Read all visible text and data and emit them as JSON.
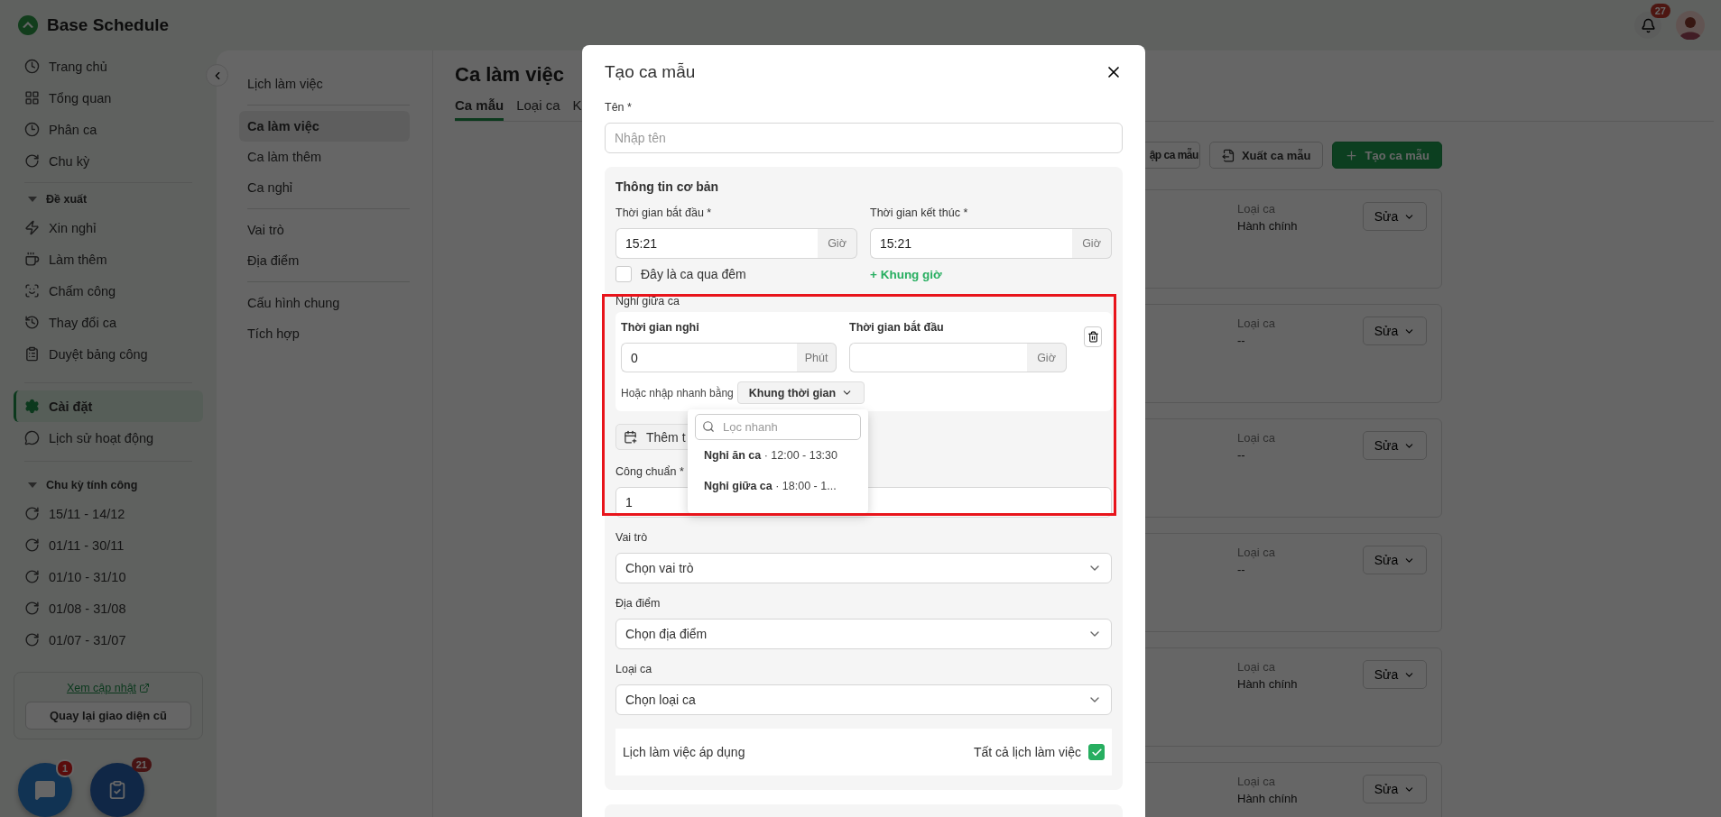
{
  "app": {
    "name": "Base Schedule",
    "notifications": "27"
  },
  "sidebar": {
    "main": [
      {
        "label": "Trang chủ",
        "selected": false
      },
      {
        "label": "Tổng quan",
        "selected": false
      },
      {
        "label": "Phân ca",
        "selected": false
      },
      {
        "label": "Chu kỳ",
        "selected": false
      }
    ],
    "proposals": {
      "title": "Đề xuất",
      "expanded": true,
      "items": [
        {
          "label": "Xin nghỉ",
          "selected": false
        },
        {
          "label": "Làm thêm",
          "selected": false
        },
        {
          "label": "Chấm công",
          "selected": false
        },
        {
          "label": "Thay đổi ca",
          "selected": false
        },
        {
          "label": "Duyệt bảng công",
          "selected": false
        }
      ]
    },
    "settings": [
      {
        "label": "Cài đặt",
        "selected": true
      },
      {
        "label": "Lịch sử hoạt động",
        "selected": false
      }
    ],
    "cycles": {
      "title": "Chu kỳ tính công",
      "expanded": true,
      "items": [
        {
          "label": "15/11 - 14/12",
          "selected": false
        },
        {
          "label": "01/11 - 30/11",
          "selected": false
        },
        {
          "label": "01/10 - 31/10",
          "selected": false
        },
        {
          "label": "01/08 - 31/08",
          "selected": false
        },
        {
          "label": "01/07 - 31/07",
          "selected": false
        }
      ]
    },
    "update_link": "Xem cập nhật",
    "legacy_button": "Quay lại giao diện cũ"
  },
  "floating": {
    "chat_badge": "1",
    "tasks_badge": "21"
  },
  "settings_nav": {
    "groups": [
      {
        "items": [
          {
            "label": "Lịch làm việc",
            "selected": false
          }
        ]
      },
      {
        "items": [
          {
            "label": "Ca làm việc",
            "selected": true
          },
          {
            "label": "Ca làm thêm",
            "selected": false
          },
          {
            "label": "Ca nghỉ",
            "selected": false
          }
        ]
      },
      {
        "items": [
          {
            "label": "Vai trò",
            "selected": false
          },
          {
            "label": "Địa điểm",
            "selected": false
          }
        ]
      },
      {
        "items": [
          {
            "label": "Cấu hình chung",
            "selected": false
          },
          {
            "label": "Tích hợp",
            "selected": false
          }
        ]
      }
    ]
  },
  "page": {
    "title": "Ca làm việc",
    "tabs": [
      {
        "label": "Ca mẫu",
        "selected": true
      },
      {
        "label": "Loại ca",
        "selected": false
      },
      {
        "label": "K",
        "selected": false
      }
    ],
    "actions": [
      {
        "kind": "import",
        "label": "ập ca mẫu"
      },
      {
        "kind": "export",
        "label": "Xuất ca mẫu"
      },
      {
        "kind": "create",
        "label": "Tạo ca mẫu"
      }
    ],
    "cards": [
      {
        "type_label": "Loại ca",
        "type_value": "Hành chính",
        "action": "Sửa"
      },
      {
        "type_label": "Loại ca",
        "type_value": "--",
        "action": "Sửa"
      },
      {
        "type_label": "Loại ca",
        "type_value": "--",
        "action": "Sửa"
      },
      {
        "type_label": "Loại ca",
        "type_value": "--",
        "action": "Sửa"
      },
      {
        "type_label": "Loại ca",
        "type_value": "Hành chính",
        "action": "Sửa"
      },
      {
        "type_label": "Loại ca",
        "type_value": "Hành chính",
        "action": "Sửa"
      }
    ]
  },
  "modal": {
    "title": "Tạo ca mẫu",
    "name": {
      "label": "Tên *",
      "placeholder": "Nhập tên"
    },
    "basic": {
      "title": "Thông tin cơ bản",
      "start": {
        "label": "Thời gian bắt đầu *",
        "value": "15:21",
        "unit": "Giờ"
      },
      "end": {
        "label": "Thời gian kết thúc *",
        "value": "15:21",
        "unit": "Giờ"
      },
      "overnight": {
        "label": "Đây là ca qua đêm",
        "checked": false
      },
      "add_slot": "+ Khung giờ",
      "break": {
        "title": "Nghỉ giữa ca",
        "duration": {
          "label": "Thời gian nghỉ",
          "value": "0",
          "unit": "Phút"
        },
        "start": {
          "label": "Thời gian bắt đầu",
          "unit": "Giờ"
        },
        "quick_label": "Hoặc nhập nhanh bằng",
        "quick_button": "Khung thời gian",
        "dropdown": {
          "placeholder": "Lọc nhanh",
          "options": [
            "**Nghỉ ăn ca** · 12:00 - 13:30",
            "**Nghỉ giữa ca** · 18:00 - 1..."
          ]
        }
      },
      "add_break": "Thêm t",
      "standard": {
        "label": "Công chuẩn *",
        "value": "1"
      },
      "selects": [
        {
          "label": "Vai trò",
          "placeholder": "Chọn vai trò"
        },
        {
          "label": "Địa điểm",
          "placeholder": "Chọn địa điểm"
        },
        {
          "label": "Loại ca",
          "placeholder": "Chọn loại ca"
        }
      ],
      "schedule": {
        "label": "Lịch làm việc áp dụng",
        "option": "Tất cả lịch làm việc",
        "checked": true
      }
    }
  }
}
